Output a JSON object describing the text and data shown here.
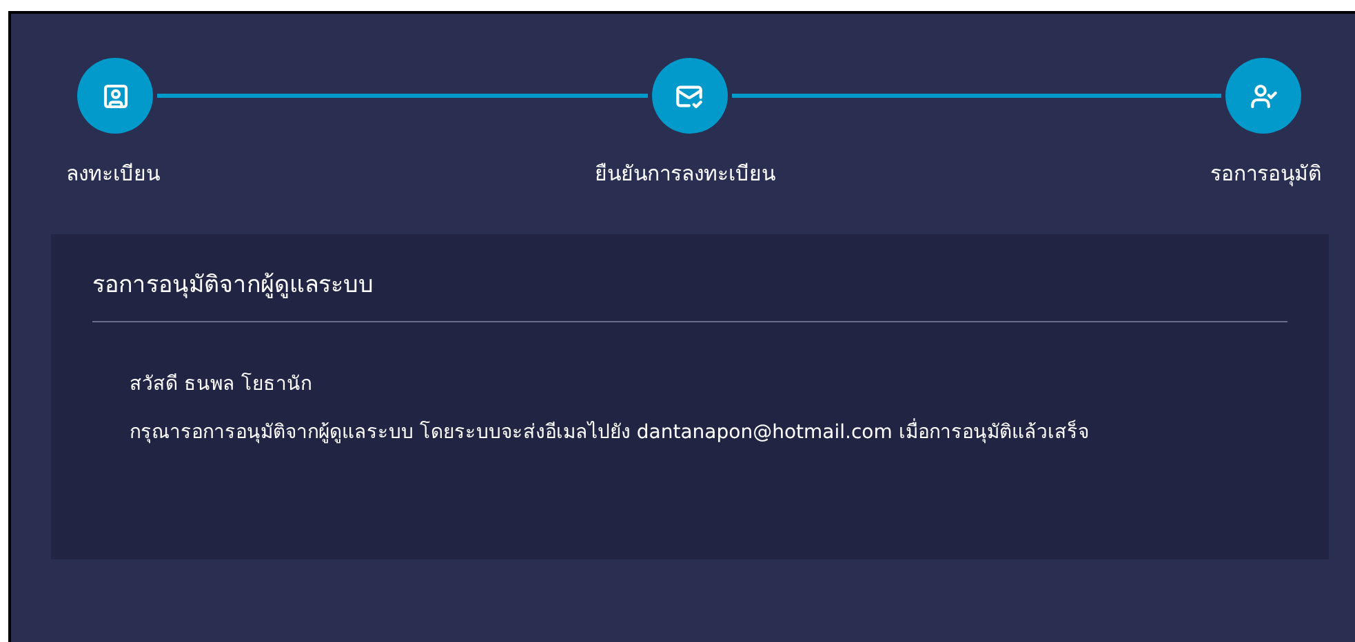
{
  "steps": [
    {
      "label": "ลงทะเบียน"
    },
    {
      "label": "ยืนยันการลงทะเบียน"
    },
    {
      "label": "รอการอนุมัติ"
    }
  ],
  "card": {
    "title": "รอการอนุมัติจากผู้ดูแลระบบ",
    "lines": [
      "สวัสดี ธนพล โยธานัก",
      "กรุณารอการอนุมัติจากผู้ดูแลระบบ โดยระบบจะส่งอีเมลไปยัง dantanapon@hotmail.com เมื่อการอนุมัติแล้วเสร็จ"
    ]
  }
}
